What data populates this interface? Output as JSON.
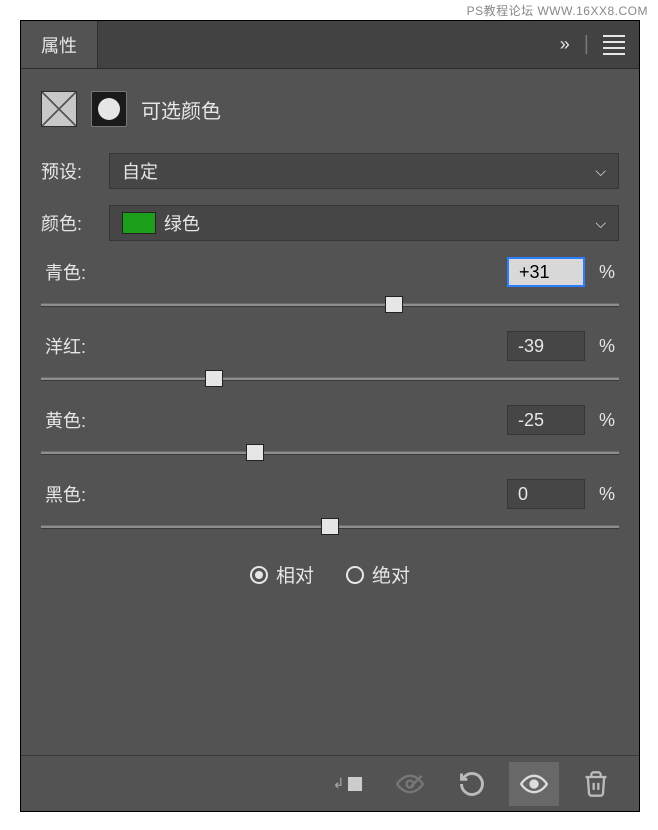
{
  "watermark": "PS教程论坛 WWW.16XX8.COM",
  "panel_title": "属性",
  "adjustment_title": "可选颜色",
  "preset": {
    "label": "预设:",
    "value": "自定"
  },
  "color": {
    "label": "颜色:",
    "value": "绿色",
    "swatch": "#1ca01c"
  },
  "sliders": {
    "cyan": {
      "label": "青色:",
      "value": "+31",
      "percent": "%",
      "pos": 61
    },
    "magenta": {
      "label": "洋红:",
      "value": "-39",
      "percent": "%",
      "pos": 30
    },
    "yellow": {
      "label": "黄色:",
      "value": "-25",
      "percent": "%",
      "pos": 37
    },
    "black": {
      "label": "黑色:",
      "value": "0",
      "percent": "%",
      "pos": 50
    }
  },
  "method": {
    "relative": "相对",
    "absolute": "绝对",
    "selected": "relative"
  }
}
